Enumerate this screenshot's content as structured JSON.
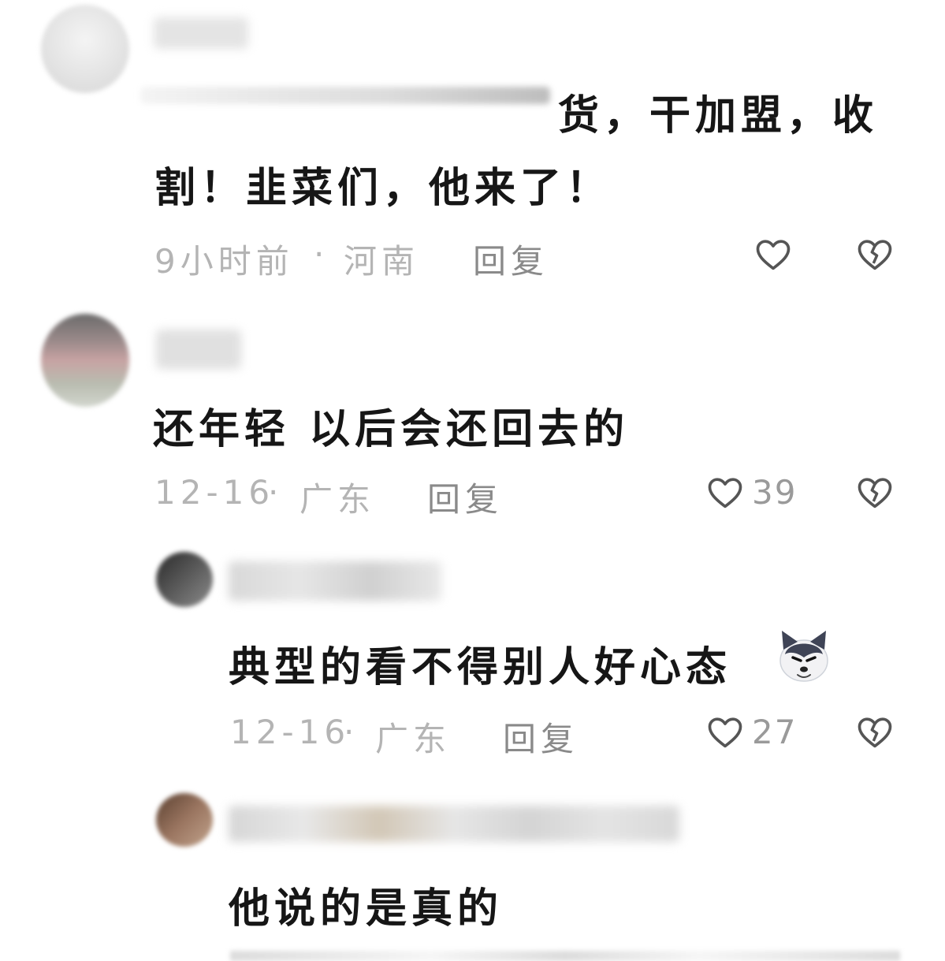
{
  "comments": [
    {
      "text_line1": "货，干加盟，收",
      "text_line2": "割！韭菜们，他来了！",
      "time": "9小时前",
      "separator": "·",
      "location": "河南",
      "reply_label": "回复",
      "likes": ""
    },
    {
      "text": "还年轻 以后会还回去的",
      "time": "12-16",
      "separator": "·",
      "location": "广东",
      "reply_label": "回复",
      "likes": "39"
    },
    {
      "text": "典型的看不得别人好心态",
      "emoji": "dog-face-emoji",
      "time": "12-16",
      "separator": "·",
      "location": "广东",
      "reply_label": "回复",
      "likes": "27"
    },
    {
      "text": "他说的是真的"
    }
  ],
  "icons": {
    "like": "heart-outline-icon",
    "dislike": "broken-heart-icon"
  },
  "colors": {
    "text": "#161616",
    "meta": "#b4b4b4",
    "reply": "#8a8a8a",
    "icon": "#555555"
  }
}
